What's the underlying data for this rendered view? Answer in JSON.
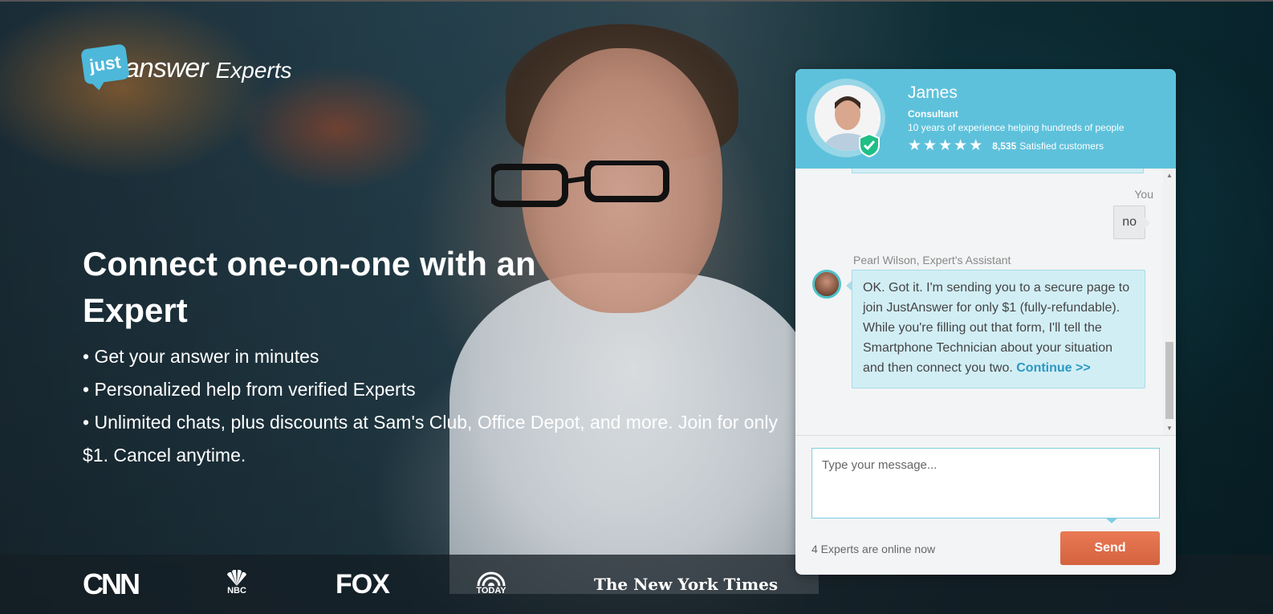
{
  "brand": {
    "logo_small": "just",
    "logo_word": "answer",
    "logo_suffix": "Experts"
  },
  "hero": {
    "headline": "Connect one-on-one with an Expert",
    "bullets": [
      "Get your answer in minutes",
      "Personalized help from verified Experts",
      "Unlimited chats, plus discounts at Sam's Club, Office Depot, and more. Join for only $1. Cancel anytime."
    ]
  },
  "press": {
    "cnn": "CNN",
    "nbc": "NBC",
    "fox": "FOX",
    "today": "TODAY",
    "nyt": "The New York Times"
  },
  "chat": {
    "expert": {
      "name": "James",
      "title": "Consultant",
      "experience": "10 years of experience helping hundreds of people",
      "rating_stars": 5,
      "satisfied_count": "8,535",
      "satisfied_label": "Satisfied customers"
    },
    "messages": {
      "you_label": "You",
      "you_text": "no",
      "assistant_label": "Pearl Wilson, Expert's Assistant",
      "assistant_text": "OK. Got it. I'm sending you to a secure page to join JustAnswer for only $1 (fully-refundable). While you're filling out that form, I'll tell the Smartphone Technician about your situation and then connect you two.",
      "continue_link": "Continue >>"
    },
    "input": {
      "placeholder": "Type your message...",
      "value": ""
    },
    "online_status": "4 Experts are online now",
    "send_label": "Send"
  },
  "colors": {
    "header_blue": "#5ec1db",
    "bubble_blue": "#d2eef5",
    "send_orange": "#e06d4a",
    "link_blue": "#2a98c4"
  },
  "icons": {
    "star": "star-icon",
    "verified": "verified-check-icon",
    "scroll_up": "scroll-up-arrow-icon",
    "scroll_down": "scroll-down-arrow-icon"
  }
}
